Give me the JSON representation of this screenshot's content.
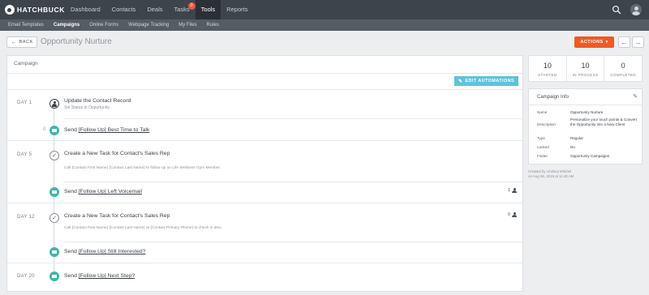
{
  "nav": {
    "brand": "HATCHBUCK",
    "items": [
      {
        "label": "Dashboard",
        "active": false
      },
      {
        "label": "Contacts",
        "active": false
      },
      {
        "label": "Deals",
        "active": false
      },
      {
        "label": "Tasks",
        "active": false,
        "badge": "0"
      },
      {
        "label": "Tools",
        "active": true
      },
      {
        "label": "Reports",
        "active": false
      }
    ]
  },
  "subnav": {
    "items": [
      {
        "label": "Email Templates",
        "active": false
      },
      {
        "label": "Campaigns",
        "active": true
      },
      {
        "label": "Online Forms",
        "active": false
      },
      {
        "label": "Webpage Tracking",
        "active": false
      },
      {
        "label": "My Files",
        "active": false
      },
      {
        "label": "Rules",
        "active": false
      }
    ]
  },
  "header": {
    "back_label": "BACK",
    "title": "Opportunity Nurture",
    "actions_label": "ACTIONS"
  },
  "panel": {
    "title": "Campaign",
    "edit_label": "EDIT AUTOMATIONS"
  },
  "timeline": {
    "days": [
      "DAY 1",
      "DAY 5",
      "DAY 12",
      "DAY 20"
    ],
    "steps": [
      {
        "title": "Update the Contact Record",
        "sub": "Set Status to Opportunity"
      },
      {
        "prefix": "Send ",
        "link": "[Follow Up] Best Time to Talk",
        "wait": "0"
      },
      {
        "title": "Create a New Task for Contact's Sales Rep",
        "desc": "Call {Contact First Name} {Contact Last Name} to follow up on Life Wellness Gym Member."
      },
      {
        "prefix": "Send ",
        "link": "[Follow Up] Left Voicemail",
        "assignee": "1"
      },
      {
        "title": "Create a New Task for Contact's Sales Rep",
        "desc": "Call {Contact First Name} {Contact Last Name} at {Contact Primary Phone} to check in also.",
        "assignee": "0"
      },
      {
        "prefix": "Send ",
        "link": "[Follow Up] Still Interested?"
      },
      {
        "prefix": "Send ",
        "link": "[Follow Up] Next Step?"
      }
    ]
  },
  "stats": [
    {
      "value": "10",
      "label": "STARTED"
    },
    {
      "value": "10",
      "label": "IN PROCESS"
    },
    {
      "value": "0",
      "label": "COMPLETED"
    }
  ],
  "info": {
    "title": "Campaign Info",
    "rows": [
      {
        "key": "Name",
        "value": "Opportunity Nurture"
      },
      {
        "key": "Description",
        "value": "Personalize your touch points & Convert the Opportunity into a New Client"
      },
      {
        "key": "Type",
        "value": "Regular"
      },
      {
        "key": "Locked",
        "value": "No"
      },
      {
        "key": "Folder",
        "value": "Opportunity Campaigns"
      }
    ],
    "created_by": "Created by Lindsey Mitchel",
    "created_on": "on Aug 06, 2018 at 11:48 AM"
  },
  "colors": {
    "nav_bg": "#3e444c",
    "accent_orange": "#ee5a24",
    "accent_teal": "#5ec3df",
    "mail_node": "#3fb6a8"
  }
}
